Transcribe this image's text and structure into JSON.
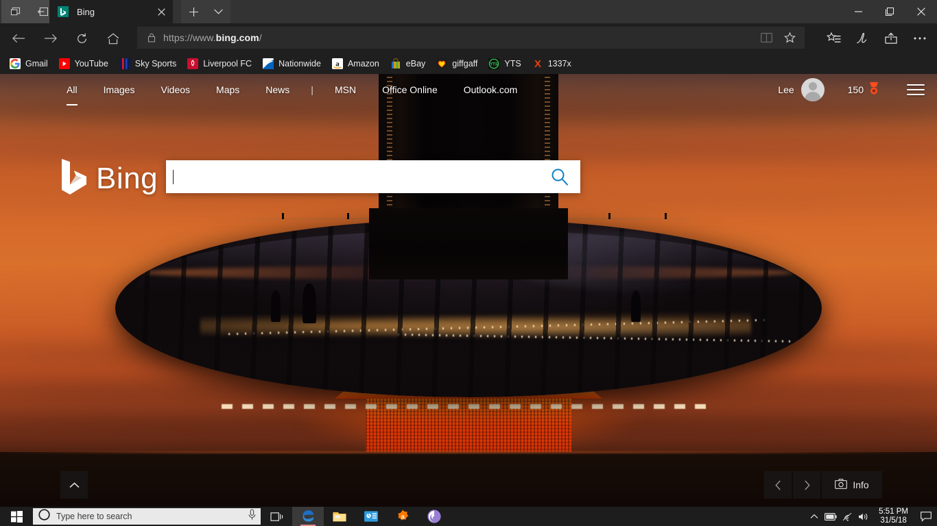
{
  "window": {
    "titlebar_buttons": [
      {
        "name": "tab-preview-icon",
        "label": ""
      },
      {
        "name": "set-tabs-aside-icon",
        "label": ""
      }
    ],
    "tab": {
      "title": "Bing",
      "favicon": "bing-favicon",
      "close": "×"
    },
    "new_tab_label": "+",
    "tab_menu_label": "⌄",
    "controls": {
      "minimize": "—",
      "maximize": "❐",
      "close": "✕"
    }
  },
  "toolbar": {
    "back": "back-arrow",
    "forward": "forward-arrow",
    "refresh": "refresh-icon",
    "home": "home-icon",
    "url_prefix": "https://www.",
    "url_domain": "bing.com",
    "url_suffix": "/",
    "url_full": "https://www.bing.com/",
    "reading_view": "reading-view-icon",
    "favorite": "star-icon",
    "hub": "hub-icon",
    "notes": "make-a-note-icon",
    "share": "share-icon",
    "more": "more-icon"
  },
  "favorites": [
    {
      "label": "Gmail",
      "icon": "gmail"
    },
    {
      "label": "YouTube",
      "icon": "youtube"
    },
    {
      "label": "Sky Sports",
      "icon": "skysports"
    },
    {
      "label": "Liverpool FC",
      "icon": "liverpool"
    },
    {
      "label": "Nationwide",
      "icon": "nationwide"
    },
    {
      "label": "Amazon",
      "icon": "amazon"
    },
    {
      "label": "eBay",
      "icon": "ebay"
    },
    {
      "label": "giffgaff",
      "icon": "giffgaff"
    },
    {
      "label": "YTS",
      "icon": "yts"
    },
    {
      "label": "1337x",
      "icon": "1337x"
    }
  ],
  "bing": {
    "nav": [
      {
        "label": "All",
        "active": true
      },
      {
        "label": "Images",
        "active": false
      },
      {
        "label": "Videos",
        "active": false
      },
      {
        "label": "Maps",
        "active": false
      },
      {
        "label": "News",
        "active": false
      }
    ],
    "separator": "|",
    "nav2": [
      {
        "label": "MSN"
      },
      {
        "label": "Office Online"
      },
      {
        "label": "Outlook.com"
      }
    ],
    "user_name": "Lee",
    "rewards_count": "150",
    "rewards_icon": "rewards-medal-icon",
    "menu_icon": "hamburger-icon",
    "logo_text": "Bing",
    "search_value": "",
    "search_placeholder": "",
    "search_icon": "search-icon",
    "scroll_up_icon": "chevron-up-icon",
    "image_prev": "‹",
    "image_next": "›",
    "info_label": "Info",
    "info_icon": "camera-icon",
    "accent_blue": "#0f7fc4",
    "rewards_color": "#ff4b1f"
  },
  "taskbar": {
    "start_icon": "windows-start-icon",
    "search_placeholder": "Type here to search",
    "cortana_icon": "cortana-circle-icon",
    "mic_icon": "microphone-icon",
    "task_view_icon": "task-view-icon",
    "apps": [
      {
        "name": "microsoft-edge",
        "running": true,
        "active": true
      },
      {
        "name": "file-explorer",
        "running": false,
        "active": false
      },
      {
        "name": "microsoft-store",
        "running": false,
        "active": false
      },
      {
        "name": "avast-antivirus",
        "running": false,
        "active": false
      },
      {
        "name": "bittorrent",
        "running": false,
        "active": false
      }
    ],
    "tray": {
      "show_hidden": "chevron-up-icon",
      "battery": "battery-icon",
      "network": "wifi-icon",
      "volume": "speaker-icon",
      "time": "5:51 PM",
      "date": "31/5/18",
      "action_center": "action-center-icon"
    }
  }
}
